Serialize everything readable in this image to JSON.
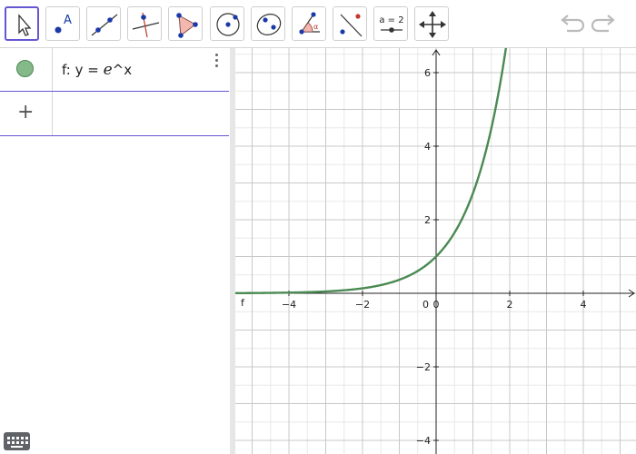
{
  "toolbar": {
    "tools": [
      {
        "icon": "move-arrow-icon",
        "active": true
      },
      {
        "icon": "point-icon",
        "point_label": "A"
      },
      {
        "icon": "line-icon"
      },
      {
        "icon": "perpendicular-line-icon"
      },
      {
        "icon": "polygon-icon"
      },
      {
        "icon": "circle-center-point-icon"
      },
      {
        "icon": "conic-five-points-icon"
      },
      {
        "icon": "angle-icon",
        "angle_label": "α"
      },
      {
        "icon": "reflect-icon"
      },
      {
        "icon": "slider-icon",
        "slider_label": "a = 2"
      },
      {
        "icon": "move-view-icon"
      }
    ],
    "undo_icon": "undo-icon",
    "redo_icon": "redo-icon"
  },
  "algebra": {
    "entries": [
      {
        "prefix": "f: y = ",
        "e": "e",
        "suffix": "^x",
        "color": "#4a8a52"
      }
    ],
    "input_plus": "+"
  },
  "graphics": {
    "function_label": "f",
    "origin_label": "0",
    "function_color": "#4a8a52"
  },
  "chart_data": {
    "type": "line",
    "function": "e^x",
    "series": [
      {
        "name": "f",
        "x": [
          -5.5,
          -5,
          -4,
          -3,
          -2,
          -1,
          -0.5,
          0,
          0.5,
          1,
          1.5,
          1.9
        ],
        "values": [
          0.004,
          0.007,
          0.018,
          0.05,
          0.135,
          0.368,
          0.607,
          1,
          1.649,
          2.718,
          4.482,
          6.686
        ]
      }
    ],
    "xlim": [
      -5.5,
      5.5
    ],
    "ylim": [
      -4.1,
      6.2
    ],
    "x_ticks": [
      -4,
      -2,
      0,
      2,
      4
    ],
    "x_tick_labels": [
      "−4",
      "−2",
      "0",
      "2",
      "4"
    ],
    "y_ticks": [
      -4,
      -2,
      2,
      4,
      6
    ],
    "y_tick_labels": [
      "−4",
      "−2",
      "2",
      "4",
      "6"
    ],
    "grid": true,
    "title": "",
    "xlabel": "",
    "ylabel": ""
  }
}
